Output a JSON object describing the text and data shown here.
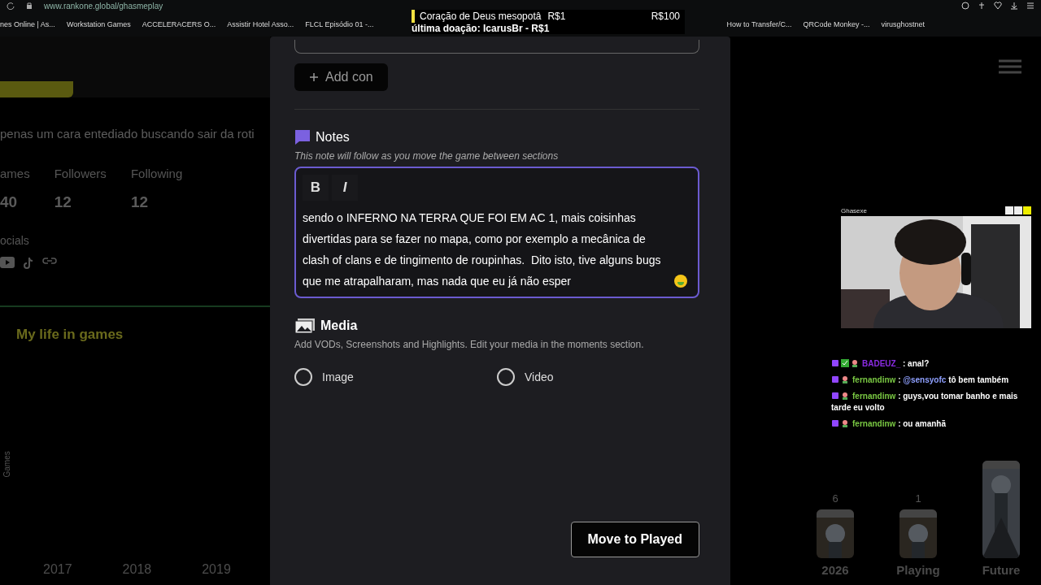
{
  "browser": {
    "url": "www.rankone.global/ghasmeplay",
    "bookmarks_left": [
      "nes Online | As...",
      "Workstation Games",
      "ACCELERACERS O...",
      "Assistir Hotel Asso...",
      "FLCL Episódio 01 -..."
    ],
    "bookmarks_right": [
      "How to Transfer/C...",
      "QRCode Monkey -...",
      "virusghostnet"
    ]
  },
  "stream_overlay": {
    "goal_title": "Coração de Deus mesopotâ",
    "goal_current": "R$1",
    "goal_target": "R$100",
    "last_donation": "última doação: IcarusBr - R$1"
  },
  "profile": {
    "bio": "penas um cara entediado buscando sair da roti",
    "stats": [
      {
        "label": "ames",
        "value": "40"
      },
      {
        "label": "Followers",
        "value": "12"
      },
      {
        "label": "Following",
        "value": "12"
      }
    ],
    "socials_label": "ocials",
    "section_title": "My life in games",
    "axis_label": "Games"
  },
  "timeline_left": [
    {
      "label": "2017"
    },
    {
      "label": "2018"
    },
    {
      "label": "2019"
    }
  ],
  "timeline_right": [
    {
      "label": "2026",
      "count": "6",
      "kind": "cover"
    },
    {
      "label": "Playing",
      "count": "1",
      "kind": "cover"
    },
    {
      "label": "Future",
      "kind": "tall"
    }
  ],
  "modal": {
    "add_button": "Add con",
    "notes": {
      "title": "Notes",
      "hint": "This note will follow as you move the game between sections",
      "toolbar": [
        "B",
        "I"
      ],
      "text": "sendo o INFERNO NA TERRA QUE FOI EM AC 1, mais coisinhas divertidas para se fazer no mapa, como por exemplo a mecânica de clash of clans e de tingimento de roupinhas.  Dito isto, tive alguns bugs que me atrapalharam, mas nada que eu já não esper"
    },
    "media": {
      "title": "Media",
      "hint": "Add VODs, Screenshots and Highlights. Edit your media in the moments section.",
      "options": [
        {
          "label": "Image",
          "selected": false
        },
        {
          "label": "Video",
          "selected": false
        }
      ]
    },
    "submit": "Move to Played"
  },
  "webcam": {
    "title": "Ghasexe"
  },
  "chat": [
    {
      "badges": [
        {
          "kind": "sub"
        },
        {
          "kind": "verified"
        },
        {
          "kind": "flower"
        }
      ],
      "user": "BADEUZ_",
      "color": "#8a2be2",
      "text": ": anal?"
    },
    {
      "badges": [
        {
          "kind": "sub"
        },
        {
          "kind": "flower"
        }
      ],
      "user": "fernandinw",
      "color": "#7ac943",
      "lead": ":",
      "mention": "@sensyofc",
      "text": "tô bem também"
    },
    {
      "badges": [
        {
          "kind": "sub"
        },
        {
          "kind": "flower"
        }
      ],
      "user": "fernandinw",
      "color": "#7ac943",
      "text": ": guys,vou tomar banho e mais tarde eu volto"
    },
    {
      "badges": [
        {
          "kind": "sub"
        },
        {
          "kind": "flower"
        }
      ],
      "user": "fernandinw",
      "color": "#7ac943",
      "text": ": ou amanhã"
    }
  ]
}
